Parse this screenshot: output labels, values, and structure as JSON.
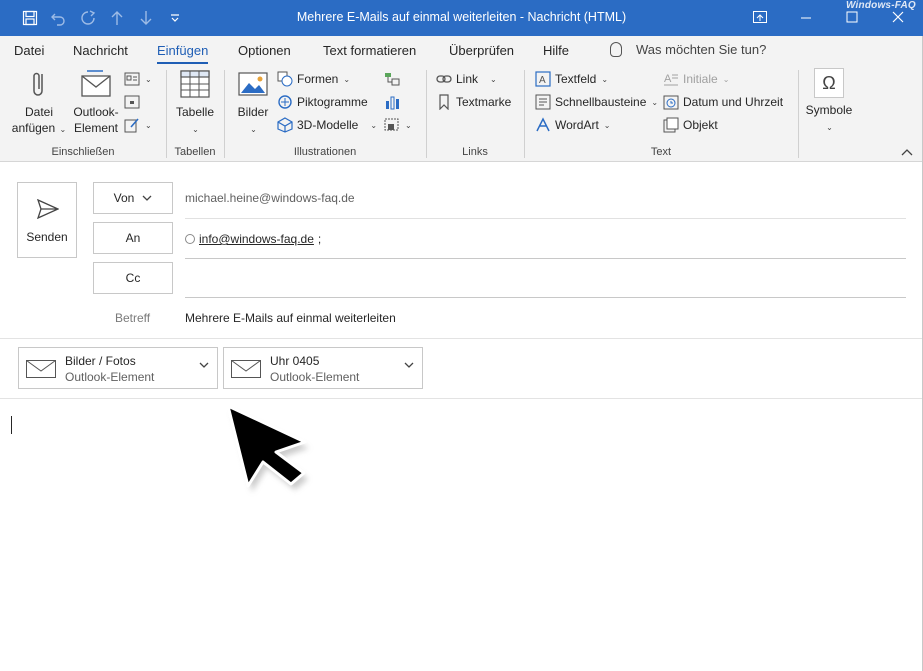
{
  "window": {
    "title": "Mehrere E-Mails auf einmal weiterleiten  -  Nachricht (HTML)",
    "watermark": "Windows-FAQ",
    "accent": "#2b6cc4"
  },
  "quick_access": {
    "icons": [
      "save-icon",
      "undo-icon",
      "redo-icon",
      "arrow-up-icon",
      "arrow-down-icon",
      "customize-icon"
    ]
  },
  "tabs": [
    {
      "label": "Datei"
    },
    {
      "label": "Nachricht"
    },
    {
      "label": "Einfügen",
      "active": true
    },
    {
      "label": "Optionen"
    },
    {
      "label": "Text formatieren"
    },
    {
      "label": "Überprüfen"
    },
    {
      "label": "Hilfe"
    }
  ],
  "tell_me": "Was möchten Sie tun?",
  "ribbon": {
    "include": {
      "group_label": "Einschließen",
      "attach_file_1": "Datei",
      "attach_file_2": "anfügen",
      "outlook_item_1": "Outlook-",
      "outlook_item_2": "Element"
    },
    "tables": {
      "group_label": "Tabellen",
      "table_label": "Tabelle"
    },
    "illustrations": {
      "group_label": "Illustrationen",
      "pictures_label": "Bilder",
      "shapes_label": "Formen",
      "icons_label": "Piktogramme",
      "models_label": "3D-Modelle"
    },
    "links": {
      "group_label": "Links",
      "link_label": "Link",
      "bookmark_label": "Textmarke"
    },
    "text": {
      "group_label": "Text",
      "textbox_label": "Textfeld",
      "quickparts_label": "Schnellbausteine",
      "wordart_label": "WordArt",
      "dropcap_label": "Initiale",
      "datetime_label": "Datum und Uhrzeit",
      "object_label": "Objekt"
    },
    "symbols": {
      "symbol_label": "Symbole"
    }
  },
  "compose": {
    "send_label": "Senden",
    "from_label": "Von",
    "from_value": "michael.heine@windows-faq.de",
    "to_label": "An",
    "to_value": "info@windows-faq.de",
    "to_suffix": ";",
    "cc_label": "Cc",
    "subject_label": "Betreff",
    "subject_value": "Mehrere E-Mails auf einmal weiterleiten"
  },
  "attachments": [
    {
      "name": "Bilder / Fotos",
      "type": "Outlook-Element"
    },
    {
      "name": "Uhr 0405",
      "type": "Outlook-Element"
    }
  ]
}
